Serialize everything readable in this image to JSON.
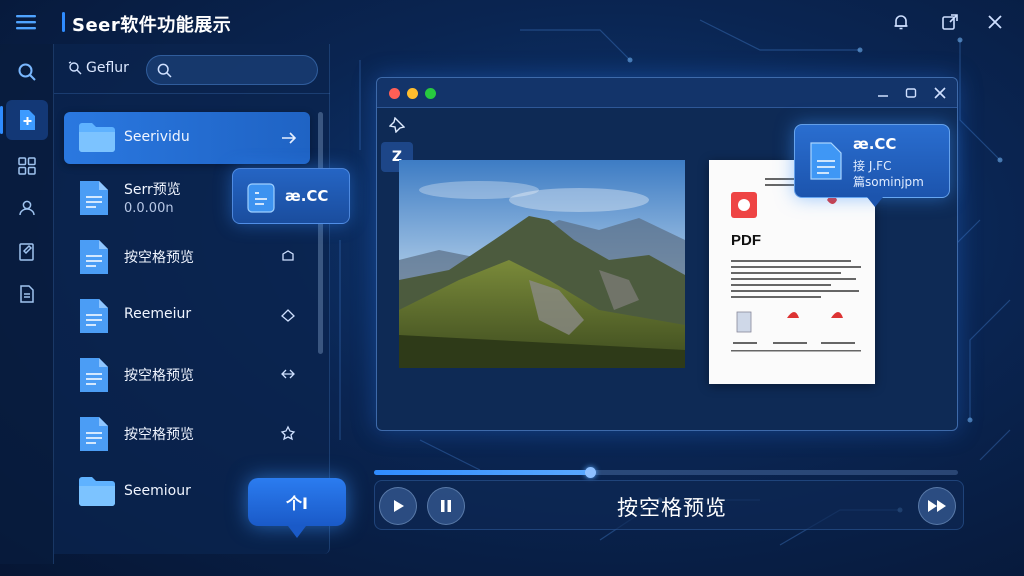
{
  "app": {
    "title": "Seer软件功能展示"
  },
  "sidebar": {
    "label": "Geflur",
    "search": {
      "placeholder": "",
      "value": ""
    },
    "items": [
      {
        "name": "Seerividu",
        "sub": "",
        "type": "folder",
        "selected": true
      },
      {
        "name": "Serr预览",
        "sub": "0.0.00n",
        "type": "document"
      },
      {
        "name": "按空格预览",
        "sub": "",
        "type": "document"
      },
      {
        "name": "Reemeiur",
        "sub": "",
        "type": "document"
      },
      {
        "name": "按空格预览",
        "sub": "",
        "type": "document"
      },
      {
        "name": "按空格预览",
        "sub": "",
        "type": "document"
      },
      {
        "name": "Seemiour",
        "sub": "",
        "type": "folder"
      }
    ]
  },
  "float_tag": {
    "label": "æ.CC"
  },
  "bubble": {
    "label": "个I"
  },
  "preview": {
    "tools": [
      {
        "label": "Z"
      }
    ],
    "pdf_label": "PDF"
  },
  "info_card": {
    "title": "æ.CC",
    "line1": "接 J.FC",
    "line2": "篇sominjpm"
  },
  "playback": {
    "label": "按空格预览",
    "progress": 0.37
  },
  "colors": {
    "accent": "#2f8cff",
    "traffic_red": "#ff5f56",
    "traffic_yellow": "#ffbd2e",
    "traffic_green": "#27c93f"
  }
}
